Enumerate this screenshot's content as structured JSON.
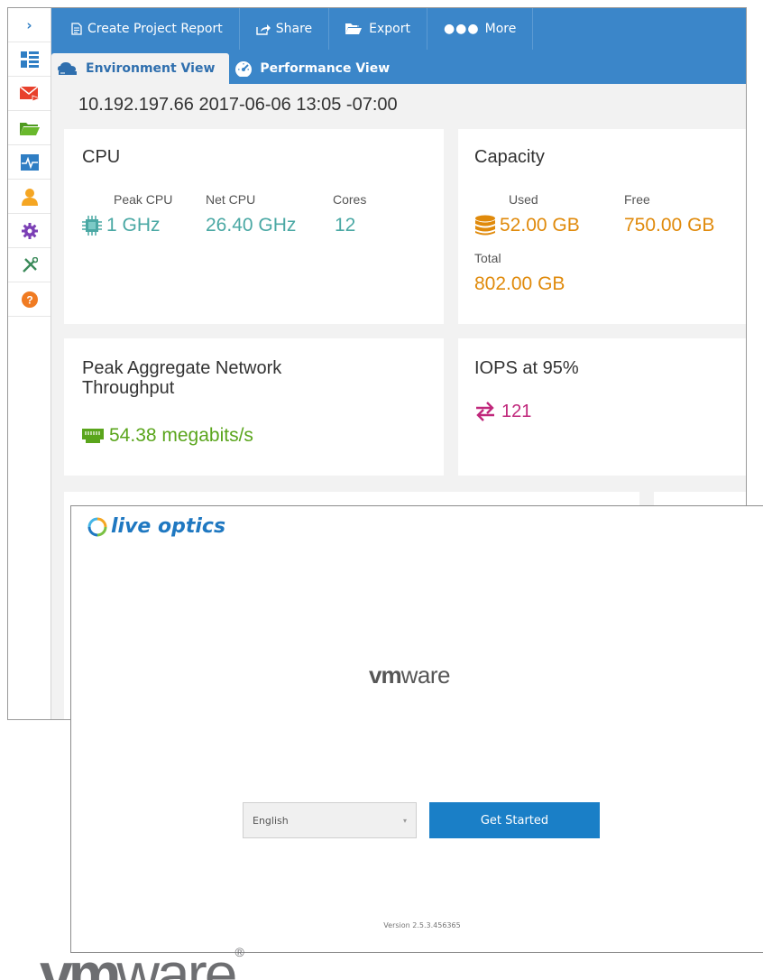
{
  "toolbar": {
    "create_report": "Create Project Report",
    "share": "Share",
    "export": "Export",
    "more": "More"
  },
  "tabs": [
    {
      "label": "Environment View",
      "active": true
    },
    {
      "label": "Performance View",
      "active": false
    }
  ],
  "sidebar": {
    "collapse_glyph": "›",
    "items": [
      "dashboard-icon",
      "mail-icon",
      "folder-icon",
      "activity-icon",
      "user-icon",
      "settings-icon",
      "tools-icon",
      "help-icon"
    ]
  },
  "host_line": "10.192.197.66 2017-06-06 13:05 -07:00",
  "cpu": {
    "title": "CPU",
    "peak_label": "Peak CPU",
    "peak_value": "1 GHz",
    "net_label": "Net CPU",
    "net_value": "26.40 GHz",
    "cores_label": "Cores",
    "cores_value": "12"
  },
  "capacity": {
    "title": "Capacity",
    "used_label": "Used",
    "used_value": "52.00 GB",
    "free_label": "Free",
    "free_value": "750.00 GB",
    "total_label": "Total",
    "total_value": "802.00 GB"
  },
  "network": {
    "title_line1": "Peak Aggregate Network",
    "title_line2": "Throughput",
    "value": "54.38 megabits/s"
  },
  "iops": {
    "title": "IOPS at 95%",
    "value": "121"
  },
  "launcher": {
    "brand": "live optics",
    "vmware_mid_bold": "vm",
    "vmware_mid_rest": "ware",
    "language": "English",
    "get_started": "Get Started",
    "version": "Version 2.5.3.456365"
  },
  "footer_logo": {
    "bold": "vm",
    "rest": "ware",
    "mark": "®"
  },
  "colors": {
    "toolbar_blue": "#3b86c9",
    "cpu_teal": "#4aa8a4",
    "capacity_orange": "#e08a0b",
    "network_green": "#5aa51c",
    "iops_magenta": "#c0277b",
    "button_blue": "#1a7fc7"
  }
}
